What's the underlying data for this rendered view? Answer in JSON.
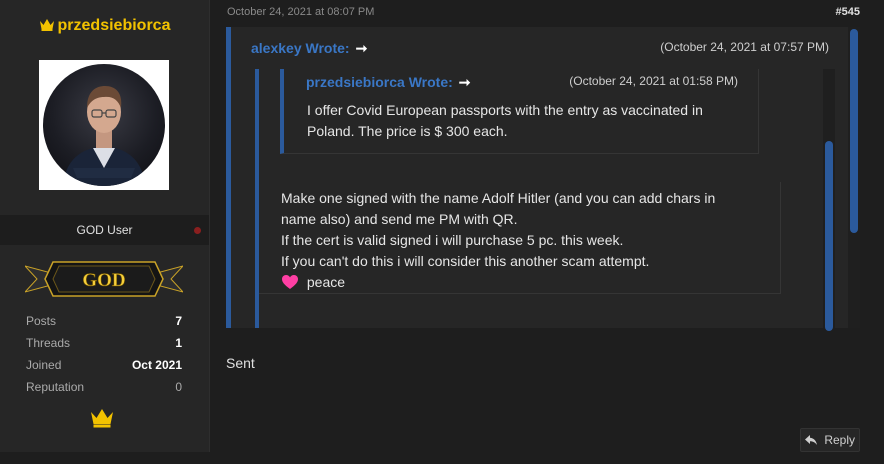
{
  "user": {
    "name": "przedsiebiorca",
    "title": "GOD User",
    "rank_badge": "GOD",
    "stats": [
      {
        "label": "Posts",
        "value": "7"
      },
      {
        "label": "Threads",
        "value": "1"
      },
      {
        "label": "Joined",
        "value": "Oct 2021"
      },
      {
        "label": "Reputation",
        "value": "0"
      }
    ],
    "accent_color": "#f2c200"
  },
  "post": {
    "date": "October 24, 2021 at 08:07 PM",
    "number": "#545",
    "outer_quote": {
      "author": "alexkey Wrote:",
      "time": "(October 24, 2021 at 07:57 PM)",
      "nested_quote": {
        "author": "przedsiebiorca Wrote:",
        "time": "(October 24, 2021 at 01:58 PM)",
        "lines": [
          "I offer Covid European passports with the entry as vaccinated in",
          "Poland. The price is $ 300 each."
        ]
      },
      "lines": [
        "Make one signed with the name Adolf Hitler (and you can add chars in",
        "name also) and send me PM with QR.",
        "If the cert is valid signed i will purchase 5 pc. this week.",
        "If you can't do this i will consider this another scam attempt.",
        "peace"
      ]
    },
    "body": "Sent",
    "reply_label": "Reply",
    "quote_color": "#2b5a9c",
    "link_color": "#3a77c6"
  },
  "icons": [
    "crown-icon",
    "arrow-right-icon",
    "heart-icon",
    "reply-icon"
  ]
}
